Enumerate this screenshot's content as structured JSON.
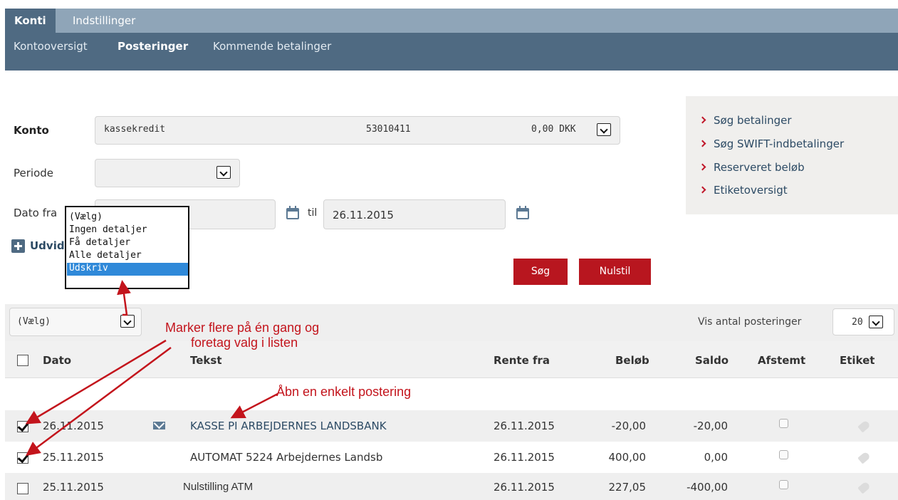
{
  "nav": {
    "tabs": [
      {
        "label": "Konti"
      },
      {
        "label": "Indstillinger"
      }
    ],
    "subtabs": [
      {
        "label": "Kontooversigt"
      },
      {
        "label": "Posteringer"
      },
      {
        "label": "Kommende betalinger"
      }
    ]
  },
  "form": {
    "konto_label": "Konto",
    "konto_name": "kassekredit",
    "konto_number": "53010411",
    "konto_balance": "0,00 DKK",
    "periode_label": "Periode",
    "periode_value": "",
    "dato_fra_label": "Dato fra",
    "dato_fra_value": "",
    "til_label": "til",
    "dato_til_value": "26.11.2015",
    "expand_label": "Udvidet søgning",
    "search_button": "Søg",
    "reset_button": "Nulstil"
  },
  "sidebar": {
    "links": [
      {
        "label": "Søg betalinger"
      },
      {
        "label": "Søg SWIFT-indbetalinger"
      },
      {
        "label": "Reserveret beløb"
      },
      {
        "label": "Etiketoversigt"
      }
    ]
  },
  "dropdown": {
    "options": [
      {
        "label": "(Vælg)"
      },
      {
        "label": "Ingen detaljer"
      },
      {
        "label": "Få detaljer"
      },
      {
        "label": "Alle detaljer"
      },
      {
        "label": "Udskriv"
      }
    ],
    "selected": "Udskriv"
  },
  "toolbar": {
    "action_select_value": "(Vælg)",
    "count_label": "Vis antal posteringer",
    "count_value": "20"
  },
  "table": {
    "headers": {
      "date": "Dato",
      "text": "Tekst",
      "interest_from": "Rente fra",
      "amount": "Beløb",
      "balance": "Saldo",
      "reconciled": "Afstemt",
      "tag": "Etiket"
    },
    "rows": [
      {
        "checked": true,
        "date": "26.11.2015",
        "text": "KASSE PI ARBEJDERNES LANDSBANK",
        "interest_from": "26.11.2015",
        "amount": "-20,00",
        "balance": "-20,00"
      },
      {
        "checked": true,
        "date": "25.11.2015",
        "text": "AUTOMAT 5224 Arbejdernes Landsb",
        "interest_from": "26.11.2015",
        "amount": "400,00",
        "balance": "0,00"
      },
      {
        "checked": false,
        "date": "25.11.2015",
        "text": "Nulstilling ATM",
        "interest_from": "26.11.2015",
        "amount": "227,05",
        "balance": "-400,00"
      }
    ]
  },
  "annotations": {
    "multi_select_line1": "Marker flere på én gang og",
    "multi_select_line2": "foretag valg i listen",
    "open_single": "Åbn en enkelt postering"
  },
  "colors": {
    "nav_light": "#8fa5b8",
    "nav_dark": "#4f6a82",
    "button_red": "#b8161f",
    "annotation_red": "#c3141c",
    "selection_blue": "#2f89d9"
  }
}
